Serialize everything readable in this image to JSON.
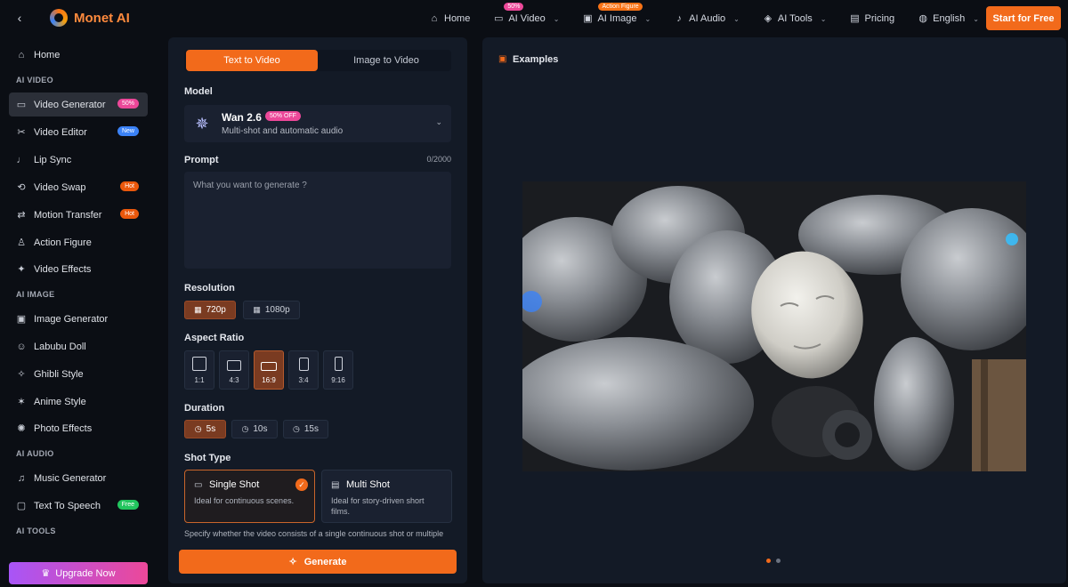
{
  "header": {
    "brand": "Monet AI",
    "nav": [
      {
        "label": "Home",
        "icon": "home-icon",
        "glyph": "⌂",
        "chevron": false,
        "badge": ""
      },
      {
        "label": "AI Video",
        "icon": "video-icon",
        "glyph": "▭",
        "chevron": true,
        "badge": "50%"
      },
      {
        "label": "AI Image",
        "icon": "image-icon",
        "glyph": "▣",
        "chevron": true,
        "badge": "Action Figure"
      },
      {
        "label": "AI Audio",
        "icon": "audio-icon",
        "glyph": "♪",
        "chevron": true,
        "badge": ""
      },
      {
        "label": "AI Tools",
        "icon": "tools-icon",
        "glyph": "◈",
        "chevron": true,
        "badge": ""
      },
      {
        "label": "Pricing",
        "icon": "pricing-icon",
        "glyph": "▤",
        "chevron": false,
        "badge": ""
      },
      {
        "label": "English",
        "icon": "globe-icon",
        "glyph": "◍",
        "chevron": true,
        "badge": ""
      }
    ],
    "cta": "Start for Free"
  },
  "sidebar": {
    "sections": {
      "ai_video": "AI VIDEO",
      "ai_image": "AI IMAGE",
      "ai_audio": "AI AUDIO",
      "ai_tools": "AI TOOLS"
    },
    "home": "Home",
    "items": [
      {
        "label": "Video Generator",
        "badge": "50%"
      },
      {
        "label": "Video Editor",
        "badge": "New"
      },
      {
        "label": "Lip Sync",
        "badge": ""
      },
      {
        "label": "Video Swap",
        "badge": "Hot"
      },
      {
        "label": "Motion Transfer",
        "badge": "Hot"
      },
      {
        "label": "Action Figure",
        "badge": ""
      },
      {
        "label": "Video Effects",
        "badge": ""
      },
      {
        "label": "Image Generator",
        "badge": ""
      },
      {
        "label": "Labubu Doll",
        "badge": ""
      },
      {
        "label": "Ghibli Style",
        "badge": ""
      },
      {
        "label": "Anime Style",
        "badge": ""
      },
      {
        "label": "Photo Effects",
        "badge": ""
      },
      {
        "label": "Music Generator",
        "badge": ""
      },
      {
        "label": "Text To Speech",
        "badge": "Free"
      }
    ],
    "upgrade": "Upgrade Now"
  },
  "form": {
    "tabs": [
      "Text to Video",
      "Image to Video"
    ],
    "model_label": "Model",
    "model": {
      "name": "Wan 2.6",
      "badge": "50% OFF",
      "desc": "Multi-shot and automatic audio"
    },
    "prompt_label": "Prompt",
    "prompt_count": "0/2000",
    "prompt_placeholder": "What you want to generate ?",
    "resolution_label": "Resolution",
    "resolutions": [
      "720p",
      "1080p"
    ],
    "aspect_label": "Aspect Ratio",
    "aspects": [
      "1:1",
      "4:3",
      "16:9",
      "3:4",
      "9:16"
    ],
    "duration_label": "Duration",
    "durations": [
      "5s",
      "10s",
      "15s"
    ],
    "shot_label": "Shot Type",
    "shots": [
      {
        "title": "Single Shot",
        "desc": "Ideal for continuous scenes."
      },
      {
        "title": "Multi Shot",
        "desc": "Ideal for story-driven short films."
      }
    ],
    "shot_hint": "Specify whether the video consists of a single continuous shot or multiple",
    "generate": "Generate"
  },
  "examples": {
    "title": "Examples"
  },
  "colors": {
    "accent": "#f26a1b",
    "panel": "#131a26",
    "background": "#0b0e14"
  }
}
